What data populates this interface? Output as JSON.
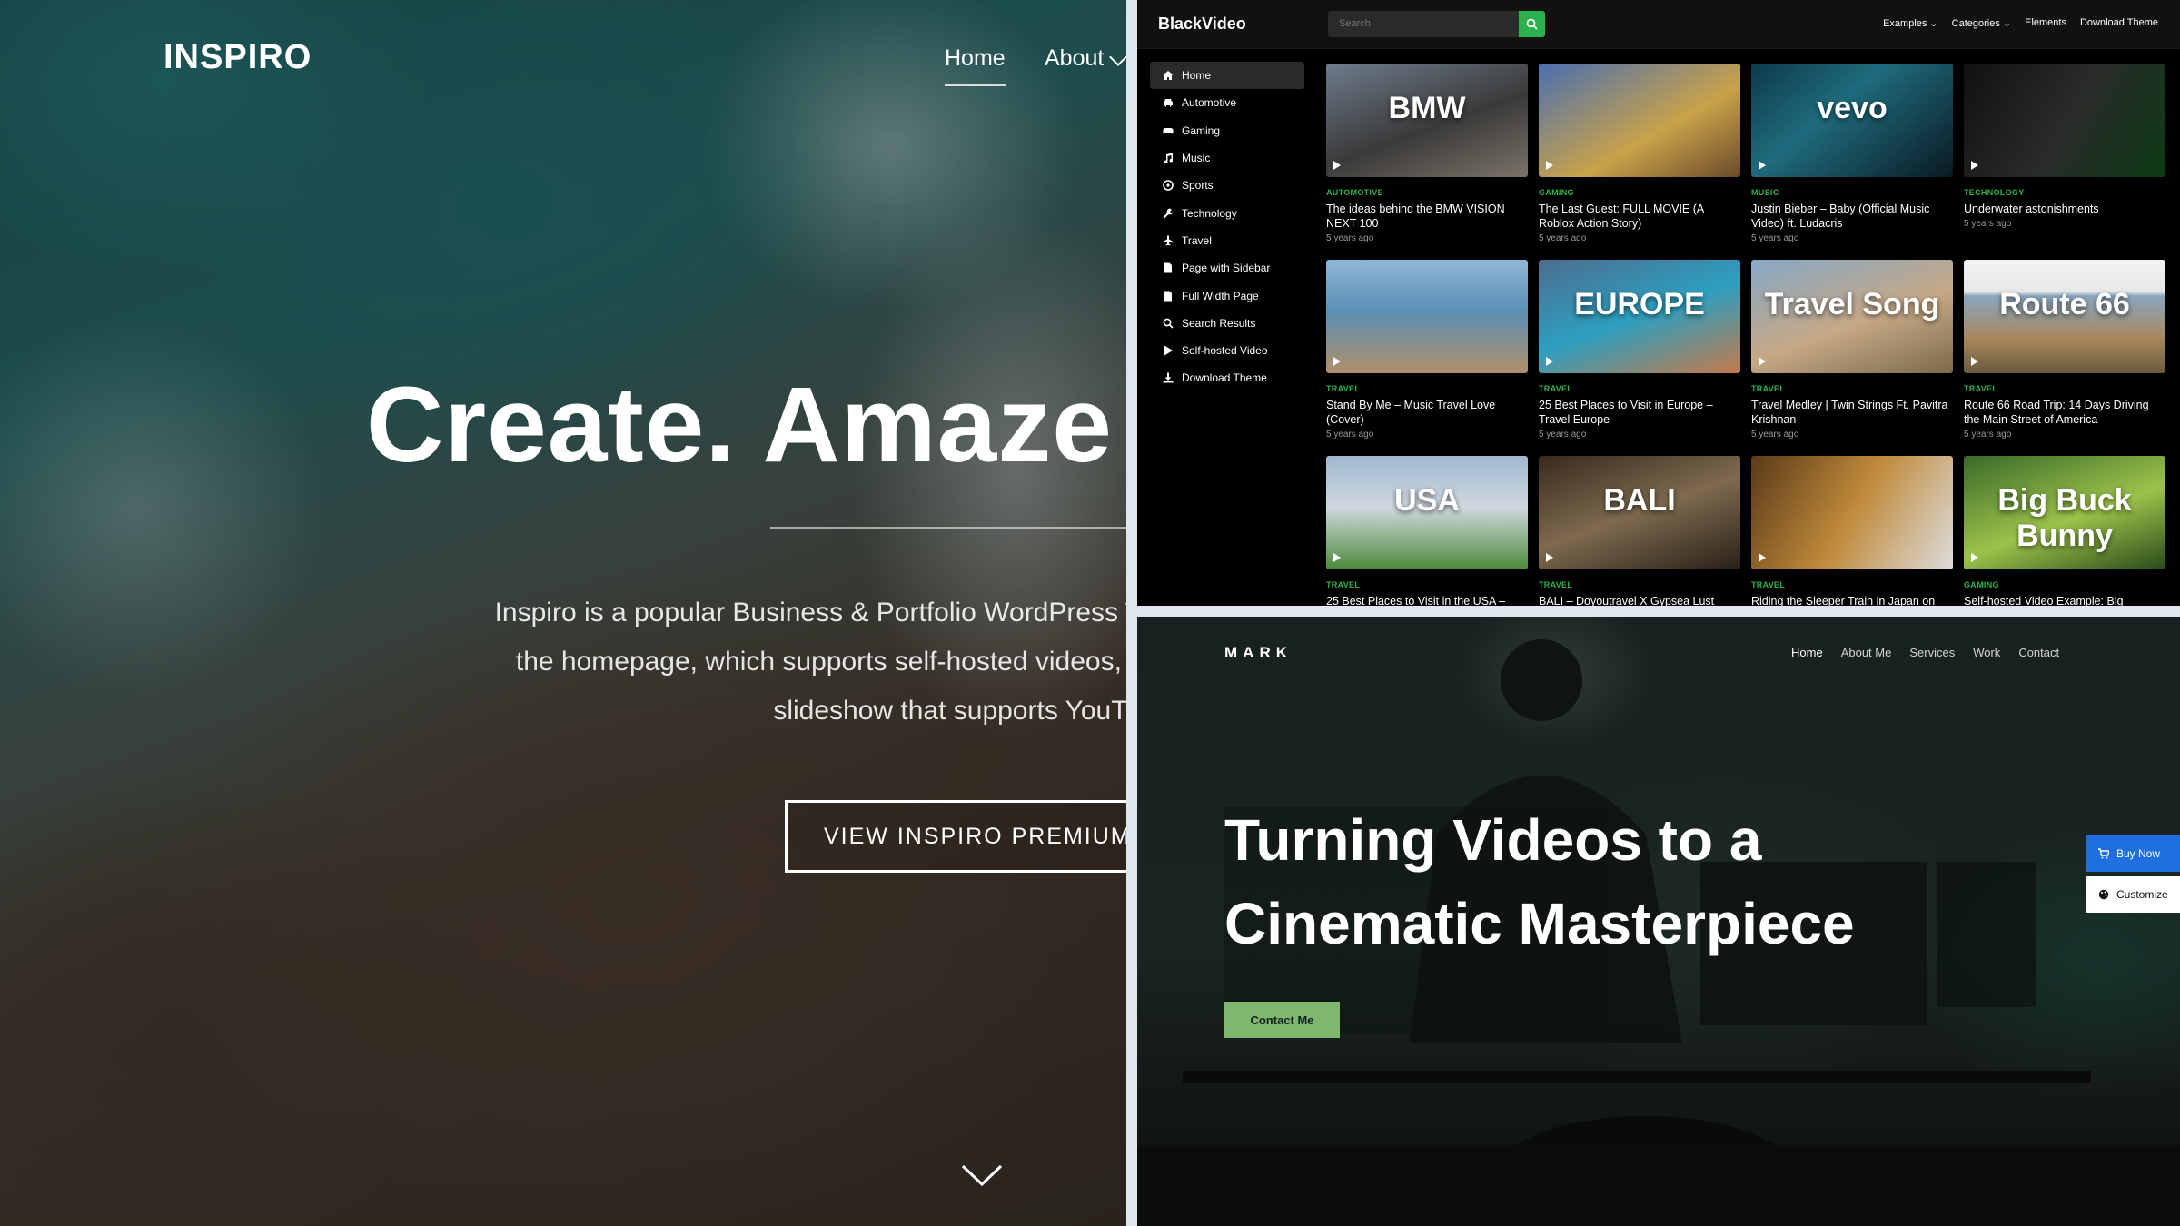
{
  "inspiro": {
    "logo": "INSPIRO",
    "nav": {
      "home": "Home",
      "about": "About"
    },
    "hero_title": "Create. Amaze",
    "description_lines": [
      "Inspiro is a popular Business & Portfolio WordPress Theme. The",
      "the homepage, which supports self-hosted videos, while the Pr",
      "slideshow that supports YouTube, Vimeo,"
    ],
    "button_label": "VIEW INSPIRO PREMIUM →"
  },
  "blackvideo": {
    "logo": "BlackVideo",
    "search_placeholder": "Search",
    "top_nav": [
      "Examples ⌄",
      "Categories ⌄",
      "Elements",
      "Download Theme"
    ],
    "sidebar": [
      {
        "label": "Home",
        "icon": "home-icon",
        "active": true
      },
      {
        "label": "Automotive",
        "icon": "car-icon"
      },
      {
        "label": "Gaming",
        "icon": "gamepad-icon"
      },
      {
        "label": "Music",
        "icon": "music-icon"
      },
      {
        "label": "Sports",
        "icon": "ball-icon"
      },
      {
        "label": "Technology",
        "icon": "wrench-icon"
      },
      {
        "label": "Travel",
        "icon": "plane-icon"
      },
      {
        "label": "Page with Sidebar",
        "icon": "page-icon"
      },
      {
        "label": "Full Width Page",
        "icon": "page-icon"
      },
      {
        "label": "Search Results",
        "icon": "search-icon"
      },
      {
        "label": "Self-hosted Video",
        "icon": "play-icon"
      },
      {
        "label": "Download Theme",
        "icon": "download-icon"
      }
    ],
    "videos": [
      {
        "category": "AUTOMOTIVE",
        "title": "The ideas behind the BMW VISION NEXT 100",
        "date": "5 years ago",
        "overlay": "BMW",
        "bg": "linear-gradient(160deg,#6d7c8c,#3b3a3a 55%,#7a7367)"
      },
      {
        "category": "GAMING",
        "title": "The Last Guest: FULL MOVIE (A Roblox Action Story)",
        "date": "5 years ago",
        "overlay": "",
        "bg": "linear-gradient(150deg,#4a6fb0,#c9a24a 60%,#6b4a2a)"
      },
      {
        "category": "MUSIC",
        "title": "Justin Bieber – Baby (Official Music Video) ft. Ludacris",
        "date": "5 years ago",
        "overlay": "vevo",
        "bg": "linear-gradient(140deg,#0d3a4a,#1f6b7d 40%,#0a1a22)"
      },
      {
        "category": "TECHNOLOGY",
        "title": "Underwater astonishments",
        "date": "5 years ago",
        "overlay": "",
        "bg": "linear-gradient(120deg,#111,#2a2a2a 50%,#0c3a14)"
      },
      {
        "category": "TRAVEL",
        "title": "Stand By Me – Music Travel Love (Cover)",
        "date": "5 years ago",
        "overlay": "",
        "bg": "linear-gradient(180deg,#8fb6d6,#5a8fb4 45%,#b08f6a)"
      },
      {
        "category": "TRAVEL",
        "title": "25 Best Places to Visit in Europe – Travel Europe",
        "date": "5 years ago",
        "overlay": "EUROPE",
        "bg": "linear-gradient(160deg,#4d6d8f,#2d9fc0 50%,#c47a4a)"
      },
      {
        "category": "TRAVEL",
        "title": "Travel Medley | Twin Strings Ft. Pavitra Krishnan",
        "date": "5 years ago",
        "overlay": "Travel Song",
        "bg": "linear-gradient(160deg,#86a8c6,#c6a886 55%,#7a6a4a)"
      },
      {
        "category": "TRAVEL",
        "title": "Route 66 Road Trip: 14 Days Driving the Main Street of America",
        "date": "5 years ago",
        "overlay": "Route 66",
        "bg": "linear-gradient(180deg,#f2f2f2 0%,#e8e8e8 28%,#8aa6c0 32%,#a8865a 70%,#6a5a40)"
      },
      {
        "category": "TRAVEL",
        "title": "25 Best Places to Visit in the USA –",
        "date": "",
        "overlay": "USA",
        "bg": "linear-gradient(180deg,#9fb7cf,#d0d8df 45%,#4c8a3a)"
      },
      {
        "category": "TRAVEL",
        "title": "BALI – Doyoutravel X Gypsea Lust",
        "date": "",
        "overlay": "BALI",
        "bg": "linear-gradient(160deg,#3a2a1e,#7d6a4f 50%,#2a2018)"
      },
      {
        "category": "TRAVEL",
        "title": "Riding the Sleeper Train in Japan on",
        "date": "",
        "overlay": "",
        "bg": "linear-gradient(120deg,#5a3a1a,#c08a3a 50%,#ddd)"
      },
      {
        "category": "GAMING",
        "title": "Self-hosted Video Example: Big",
        "date": "",
        "overlay": "Big Buck Bunny",
        "bg": "linear-gradient(160deg,#3a6a2a,#9cc24a 55%,#2a4a1a)"
      }
    ]
  },
  "mark": {
    "logo": "MARK",
    "nav": [
      "Home",
      "About Me",
      "Services",
      "Work",
      "Contact"
    ],
    "headline_1": "Turning Videos to a",
    "headline_2": "Cinematic Masterpiece",
    "contact_button": "Contact Me",
    "buy_now": "Buy Now",
    "customize": "Customize",
    "colors": {
      "accent": "#7fb86c",
      "buy": "#1f6fe0"
    }
  }
}
